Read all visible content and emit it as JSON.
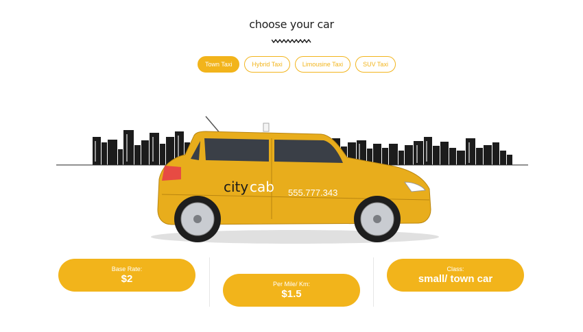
{
  "header": {
    "title": "choose your car"
  },
  "tabs": [
    {
      "label": "Town Taxi",
      "active": true
    },
    {
      "label": "Hybrid Taxi",
      "active": false
    },
    {
      "label": "Limousine Taxi",
      "active": false
    },
    {
      "label": "SUV Taxi",
      "active": false
    }
  ],
  "car": {
    "brand_part1": "city",
    "brand_part2": "cab",
    "phone": "555.777.343",
    "color": "#e8ad1c"
  },
  "stats": {
    "base_rate": {
      "label": "Base Rate:",
      "value": "$2"
    },
    "per_mile": {
      "label": "Per Mile/ Km:",
      "value": "$1.5"
    },
    "class": {
      "label": "Class:",
      "value": "small/ town car"
    }
  },
  "theme": {
    "accent": "#f2b41b"
  }
}
